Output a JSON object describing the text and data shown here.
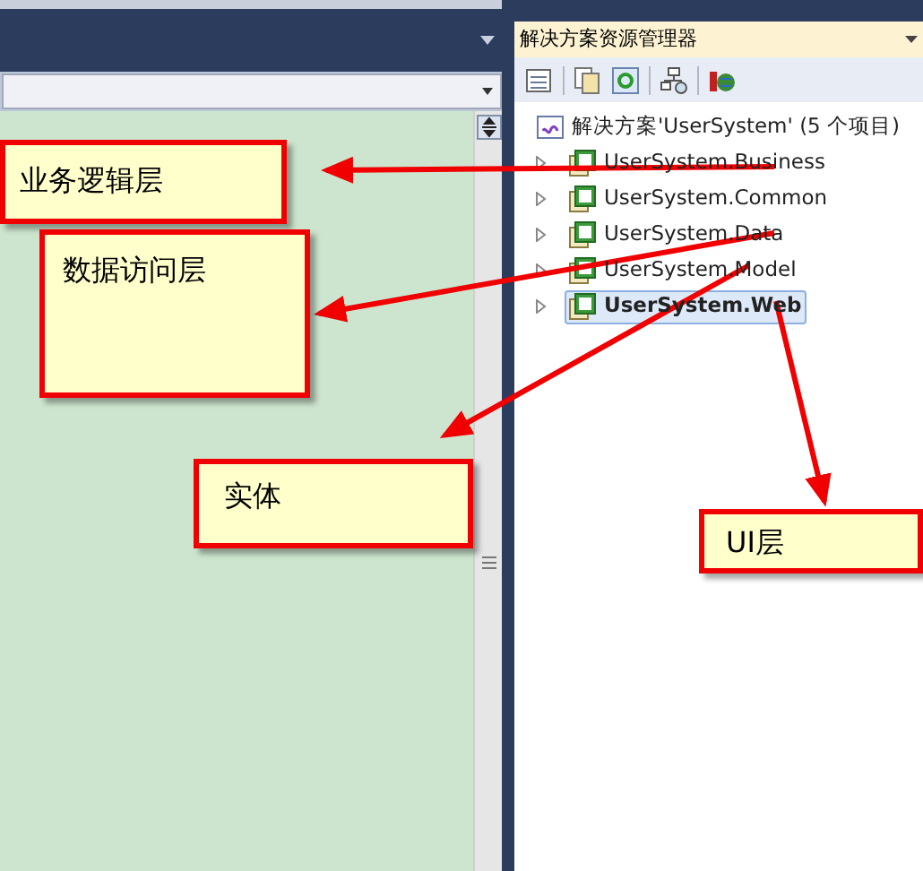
{
  "solution_explorer": {
    "title": "解决方案资源管理器",
    "root": "解决方案'UserSystem' (5 个项目)",
    "projects": [
      {
        "name": "UserSystem.Business",
        "selected": false
      },
      {
        "name": "UserSystem.Common",
        "selected": false
      },
      {
        "name": "UserSystem.Data",
        "selected": false
      },
      {
        "name": "UserSystem.Model",
        "selected": false
      },
      {
        "name": "UserSystem.Web",
        "selected": true
      }
    ]
  },
  "callouts": [
    {
      "text": "业务逻辑层"
    },
    {
      "text": "数据访问层"
    },
    {
      "text": "实体"
    },
    {
      "text": "UI层"
    }
  ]
}
